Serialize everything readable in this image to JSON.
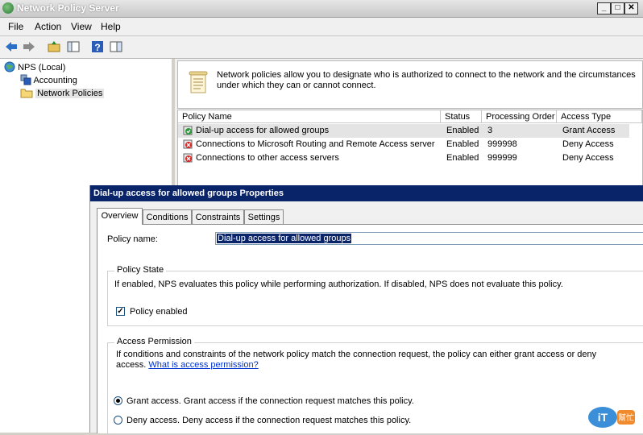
{
  "window": {
    "title": "Network Policy Server"
  },
  "menu": {
    "file": "File",
    "action": "Action",
    "view": "View",
    "help": "Help"
  },
  "tree": {
    "root": "NPS (Local)",
    "accounting": "Accounting",
    "network_policies": "Network Policies"
  },
  "info": {
    "text": "Network policies allow you to designate who is authorized to connect to the network and the circumstances under which they can or cannot connect."
  },
  "list": {
    "headers": {
      "name": "Policy Name",
      "status": "Status",
      "order": "Processing Order",
      "access": "Access Type"
    },
    "rows": [
      {
        "name": "Dial-up access for allowed groups",
        "status": "Enabled",
        "order": "3",
        "access": "Grant Access"
      },
      {
        "name": "Connections to Microsoft Routing and Remote Access server",
        "status": "Enabled",
        "order": "999998",
        "access": "Deny Access"
      },
      {
        "name": "Connections to other access servers",
        "status": "Enabled",
        "order": "999999",
        "access": "Deny Access"
      }
    ]
  },
  "dialog": {
    "title": "Dial-up access for allowed groups Properties",
    "tabs": {
      "overview": "Overview",
      "conditions": "Conditions",
      "constraints": "Constraints",
      "settings": "Settings"
    },
    "policy_name_label": "Policy name:",
    "policy_name_value": "Dial-up access for allowed groups",
    "policy_state": {
      "title": "Policy State",
      "desc": "If enabled, NPS evaluates this policy while performing authorization. If disabled, NPS does not evaluate this policy.",
      "enabled_label": "Policy enabled"
    },
    "access_permission": {
      "title": "Access Permission",
      "desc1": "If conditions and constraints of the network policy match the connection request, the policy can either grant access or deny",
      "desc2": "access.",
      "link": "What is access permission?",
      "grant_label": "Grant access. Grant access if the connection request matches this policy.",
      "deny_label": "Deny access. Deny access if the connection request matches this policy."
    }
  },
  "colors": {
    "selection": "#0a246a",
    "link": "#0033cc"
  }
}
